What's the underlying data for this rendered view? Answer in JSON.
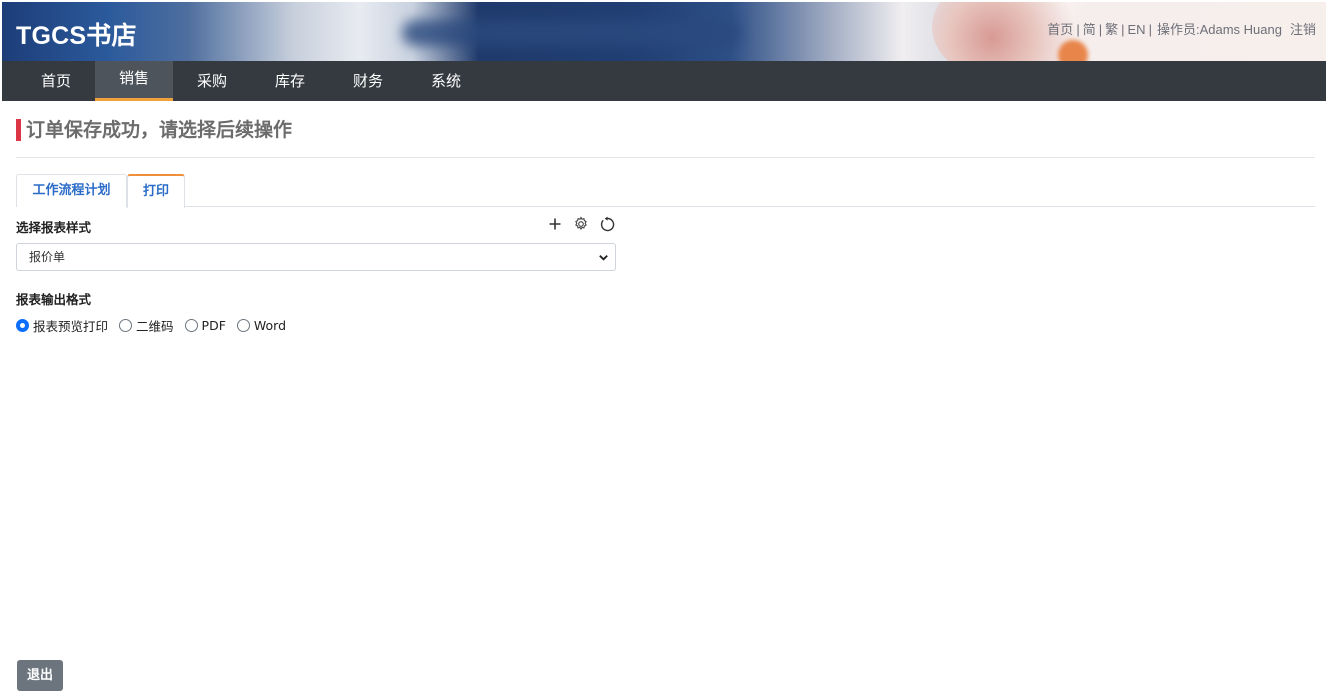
{
  "header": {
    "brand": "TGCS书店",
    "links": {
      "home": "首页",
      "simplified": "简",
      "traditional": "繁",
      "english": "EN",
      "operator_label": "操作员:",
      "operator_name": "Adams Huang",
      "logout": "注销"
    }
  },
  "nav": {
    "items": [
      {
        "label": "首页"
      },
      {
        "label": "销售",
        "active": true
      },
      {
        "label": "采购"
      },
      {
        "label": "库存"
      },
      {
        "label": "财务"
      },
      {
        "label": "系统"
      }
    ]
  },
  "page": {
    "title": "订单保存成功，请选择后续操作"
  },
  "tabs": {
    "workflow": "工作流程计划",
    "print": "打印",
    "active": "print"
  },
  "form": {
    "report_style_label": "选择报表样式",
    "report_style_value": "报价单",
    "output_format_label": "报表输出格式",
    "output_options": [
      {
        "label": "报表预览打印",
        "checked": true
      },
      {
        "label": "二维码",
        "checked": false
      },
      {
        "label": "PDF",
        "checked": false
      },
      {
        "label": "Word",
        "checked": false
      }
    ]
  },
  "footer": {
    "exit_label": "退出"
  },
  "colors": {
    "navbar": "#343a40",
    "active_tab_accent": "#f0a23a",
    "title_bar_accent": "#dc3545",
    "link_blue": "#2a6cc7",
    "exit_button": "#6c757d"
  },
  "icons": [
    "plus-icon",
    "gear-icon",
    "refresh-icon",
    "chevron-down-icon"
  ]
}
